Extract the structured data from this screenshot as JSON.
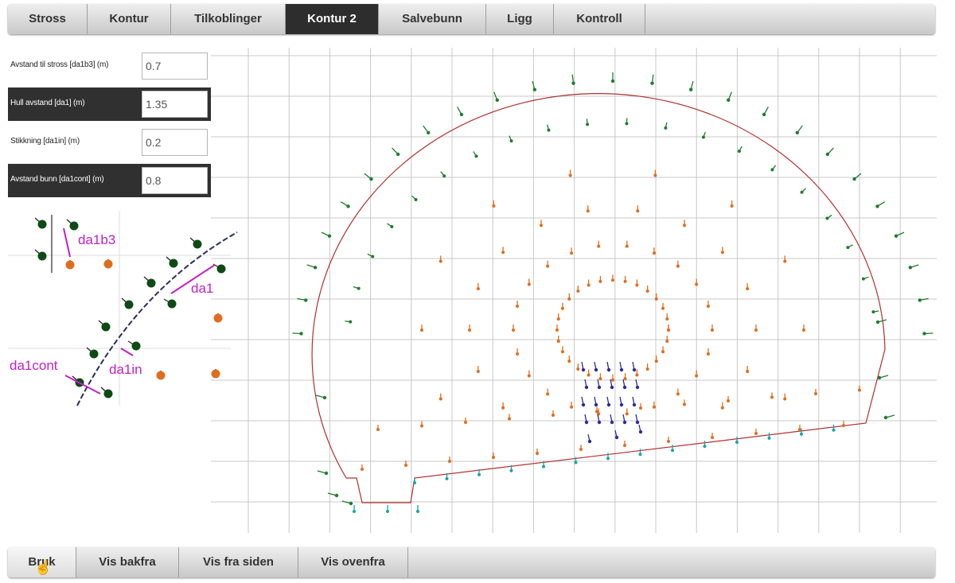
{
  "tabs": [
    {
      "label": "Stross"
    },
    {
      "label": "Kontur"
    },
    {
      "label": "Tilkoblinger"
    },
    {
      "label": "Kontur 2",
      "active": true
    },
    {
      "label": "Salvebunn"
    },
    {
      "label": "Ligg"
    },
    {
      "label": "Kontroll"
    }
  ],
  "fields": [
    {
      "label": "Avstand til stross [da1b3] (m)",
      "value": "0.7"
    },
    {
      "label": "Hull avstand [da1] (m)",
      "value": "1.35"
    },
    {
      "label": "Stikkning [da1in] (m)",
      "value": "0.2"
    },
    {
      "label": "Avstand bunn [da1cont] (m)",
      "value": "0.8"
    }
  ],
  "diagram": {
    "labels": {
      "da1b3": "da1b3",
      "da1": "da1",
      "da1in": "da1in",
      "da1cont": "da1cont"
    },
    "colors": {
      "contour_hole": "#0d4a16",
      "inner_hole": "#e06d1e",
      "dimension": "#c020c8",
      "contour_line": "#2d2d5a"
    }
  },
  "plot": {
    "colors": {
      "grid": "#c8c8c8",
      "profile": "#b03030",
      "contour_hole": "#1e7d2b",
      "inner_hole": "#e06d1e",
      "floor_hole": "#1aa5a5",
      "cut_hole": "#2c2c9a"
    }
  },
  "view_buttons": [
    {
      "label": "Bruk",
      "active": true
    },
    {
      "label": "Vis bakfra"
    },
    {
      "label": "Vis fra siden"
    },
    {
      "label": "Vis ovenfra"
    }
  ]
}
